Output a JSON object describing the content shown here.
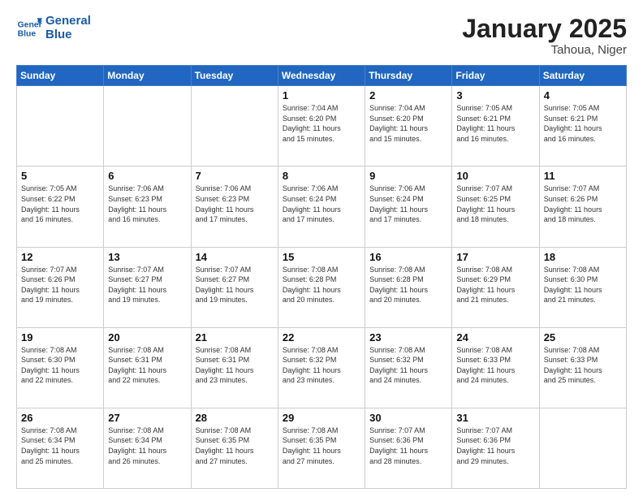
{
  "logo": {
    "name": "General",
    "name2": "Blue"
  },
  "title": "January 2025",
  "subtitle": "Tahoua, Niger",
  "weekdays": [
    "Sunday",
    "Monday",
    "Tuesday",
    "Wednesday",
    "Thursday",
    "Friday",
    "Saturday"
  ],
  "weeks": [
    [
      {
        "day": "",
        "info": "",
        "empty": true
      },
      {
        "day": "",
        "info": "",
        "empty": true
      },
      {
        "day": "",
        "info": "",
        "empty": true
      },
      {
        "day": "1",
        "info": "Sunrise: 7:04 AM\nSunset: 6:20 PM\nDaylight: 11 hours\nand 15 minutes."
      },
      {
        "day": "2",
        "info": "Sunrise: 7:04 AM\nSunset: 6:20 PM\nDaylight: 11 hours\nand 15 minutes."
      },
      {
        "day": "3",
        "info": "Sunrise: 7:05 AM\nSunset: 6:21 PM\nDaylight: 11 hours\nand 16 minutes."
      },
      {
        "day": "4",
        "info": "Sunrise: 7:05 AM\nSunset: 6:21 PM\nDaylight: 11 hours\nand 16 minutes."
      }
    ],
    [
      {
        "day": "5",
        "info": "Sunrise: 7:05 AM\nSunset: 6:22 PM\nDaylight: 11 hours\nand 16 minutes."
      },
      {
        "day": "6",
        "info": "Sunrise: 7:06 AM\nSunset: 6:23 PM\nDaylight: 11 hours\nand 16 minutes."
      },
      {
        "day": "7",
        "info": "Sunrise: 7:06 AM\nSunset: 6:23 PM\nDaylight: 11 hours\nand 17 minutes."
      },
      {
        "day": "8",
        "info": "Sunrise: 7:06 AM\nSunset: 6:24 PM\nDaylight: 11 hours\nand 17 minutes."
      },
      {
        "day": "9",
        "info": "Sunrise: 7:06 AM\nSunset: 6:24 PM\nDaylight: 11 hours\nand 17 minutes."
      },
      {
        "day": "10",
        "info": "Sunrise: 7:07 AM\nSunset: 6:25 PM\nDaylight: 11 hours\nand 18 minutes."
      },
      {
        "day": "11",
        "info": "Sunrise: 7:07 AM\nSunset: 6:26 PM\nDaylight: 11 hours\nand 18 minutes."
      }
    ],
    [
      {
        "day": "12",
        "info": "Sunrise: 7:07 AM\nSunset: 6:26 PM\nDaylight: 11 hours\nand 19 minutes."
      },
      {
        "day": "13",
        "info": "Sunrise: 7:07 AM\nSunset: 6:27 PM\nDaylight: 11 hours\nand 19 minutes."
      },
      {
        "day": "14",
        "info": "Sunrise: 7:07 AM\nSunset: 6:27 PM\nDaylight: 11 hours\nand 19 minutes."
      },
      {
        "day": "15",
        "info": "Sunrise: 7:08 AM\nSunset: 6:28 PM\nDaylight: 11 hours\nand 20 minutes."
      },
      {
        "day": "16",
        "info": "Sunrise: 7:08 AM\nSunset: 6:28 PM\nDaylight: 11 hours\nand 20 minutes."
      },
      {
        "day": "17",
        "info": "Sunrise: 7:08 AM\nSunset: 6:29 PM\nDaylight: 11 hours\nand 21 minutes."
      },
      {
        "day": "18",
        "info": "Sunrise: 7:08 AM\nSunset: 6:30 PM\nDaylight: 11 hours\nand 21 minutes."
      }
    ],
    [
      {
        "day": "19",
        "info": "Sunrise: 7:08 AM\nSunset: 6:30 PM\nDaylight: 11 hours\nand 22 minutes."
      },
      {
        "day": "20",
        "info": "Sunrise: 7:08 AM\nSunset: 6:31 PM\nDaylight: 11 hours\nand 22 minutes."
      },
      {
        "day": "21",
        "info": "Sunrise: 7:08 AM\nSunset: 6:31 PM\nDaylight: 11 hours\nand 23 minutes."
      },
      {
        "day": "22",
        "info": "Sunrise: 7:08 AM\nSunset: 6:32 PM\nDaylight: 11 hours\nand 23 minutes."
      },
      {
        "day": "23",
        "info": "Sunrise: 7:08 AM\nSunset: 6:32 PM\nDaylight: 11 hours\nand 24 minutes."
      },
      {
        "day": "24",
        "info": "Sunrise: 7:08 AM\nSunset: 6:33 PM\nDaylight: 11 hours\nand 24 minutes."
      },
      {
        "day": "25",
        "info": "Sunrise: 7:08 AM\nSunset: 6:33 PM\nDaylight: 11 hours\nand 25 minutes."
      }
    ],
    [
      {
        "day": "26",
        "info": "Sunrise: 7:08 AM\nSunset: 6:34 PM\nDaylight: 11 hours\nand 25 minutes."
      },
      {
        "day": "27",
        "info": "Sunrise: 7:08 AM\nSunset: 6:34 PM\nDaylight: 11 hours\nand 26 minutes."
      },
      {
        "day": "28",
        "info": "Sunrise: 7:08 AM\nSunset: 6:35 PM\nDaylight: 11 hours\nand 27 minutes."
      },
      {
        "day": "29",
        "info": "Sunrise: 7:08 AM\nSunset: 6:35 PM\nDaylight: 11 hours\nand 27 minutes."
      },
      {
        "day": "30",
        "info": "Sunrise: 7:07 AM\nSunset: 6:36 PM\nDaylight: 11 hours\nand 28 minutes."
      },
      {
        "day": "31",
        "info": "Sunrise: 7:07 AM\nSunset: 6:36 PM\nDaylight: 11 hours\nand 29 minutes."
      },
      {
        "day": "",
        "info": "",
        "empty": true
      }
    ]
  ]
}
